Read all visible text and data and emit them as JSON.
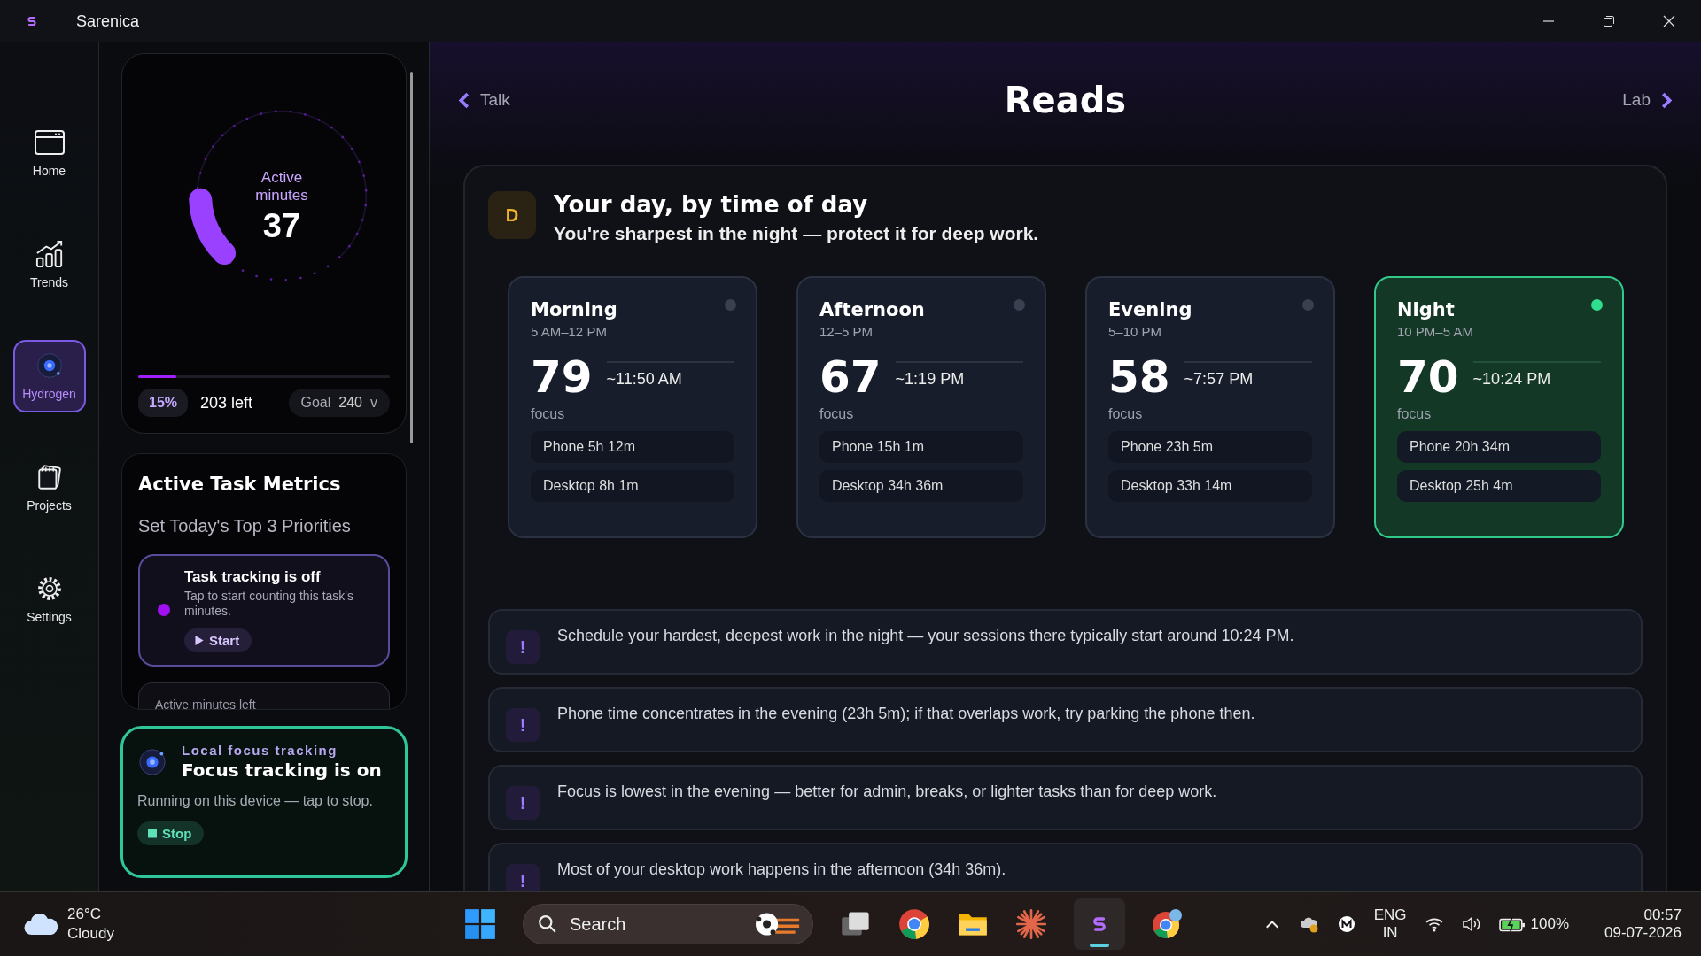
{
  "window": {
    "title": "Sarenica"
  },
  "nav": [
    {
      "label": "Home",
      "kind": "home",
      "selected": false
    },
    {
      "label": "Trends",
      "kind": "trends",
      "selected": false
    },
    {
      "label": "Hydrogen",
      "kind": "hydrogen",
      "selected": true
    },
    {
      "label": "Projects",
      "kind": "projects",
      "selected": false
    },
    {
      "label": "Settings",
      "kind": "settings",
      "selected": false
    }
  ],
  "gauge": {
    "label": "Active minutes",
    "value": "37",
    "level": 0.15,
    "percent": "15%",
    "left": "203 left",
    "goal_label": "Goal",
    "goal_value": "240",
    "goal_caret": "v"
  },
  "task_metrics": {
    "title": "Active Task Metrics",
    "subtitle": "Set Today's Top 3 Priorities",
    "tracking": {
      "title": "Task tracking is off",
      "description": "Tap to start counting this task's minutes.",
      "button": "Start"
    },
    "next_card": "Active minutes left"
  },
  "focus_tracking": {
    "eyebrow": "Local focus tracking",
    "title": "Focus tracking is on",
    "description": "Running on this device — tap to stop.",
    "button": "Stop"
  },
  "header": {
    "back": "Talk",
    "title": "Reads",
    "forward": "Lab"
  },
  "summary": {
    "badge": "D",
    "title": "Your day, by time of day",
    "subtitle": "You're sharpest in the night — protect it for deep work."
  },
  "periods": [
    {
      "name": "Morning",
      "hours": "5 AM–12 PM",
      "score": "79",
      "score_label": "focus",
      "typical_start": "~11:50 AM",
      "phone": "Phone 5h 12m",
      "desktop": "Desktop 8h 1m",
      "selected": false
    },
    {
      "name": "Afternoon",
      "hours": "12–5 PM",
      "score": "67",
      "score_label": "focus",
      "typical_start": "~1:19 PM",
      "phone": "Phone 15h 1m",
      "desktop": "Desktop 34h 36m",
      "selected": false
    },
    {
      "name": "Evening",
      "hours": "5–10 PM",
      "score": "58",
      "score_label": "focus",
      "typical_start": "~7:57 PM",
      "phone": "Phone 23h 5m",
      "desktop": "Desktop 33h 14m",
      "selected": false
    },
    {
      "name": "Night",
      "hours": "10 PM–5 AM",
      "score": "70",
      "score_label": "focus",
      "typical_start": "~10:24 PM",
      "phone": "Phone 20h 34m",
      "desktop": "Desktop 25h 4m",
      "selected": true
    }
  ],
  "insights": [
    {
      "mark": "!",
      "text": "Schedule your hardest, deepest work in the night — your sessions there typically start around 10:24 PM."
    },
    {
      "mark": "!",
      "text": "Phone time concentrates in the evening (23h 5m); if that overlaps work, try parking the phone then."
    },
    {
      "mark": "!",
      "text": "Focus is lowest in the evening — better for admin, breaks, or lighter tasks than for deep work."
    },
    {
      "mark": "!",
      "text": "Most of your desktop work happens in the afternoon (34h 36m)."
    }
  ],
  "taskbar": {
    "weather": {
      "temp": "26°C",
      "condition": "Cloudy"
    },
    "search": {
      "placeholder": "Search"
    },
    "tray": {
      "language": "ENG",
      "region": "IN",
      "battery": "100%",
      "time": "00:57",
      "date": "09-07-2026"
    }
  }
}
